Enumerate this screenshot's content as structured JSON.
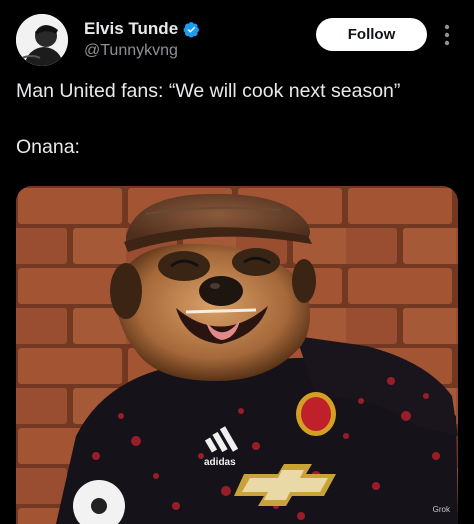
{
  "author": {
    "display_name": "Elvis Tunde",
    "handle": "@Tunnykvng",
    "verified": true,
    "avatar_icon": "avatar-user-icon"
  },
  "actions": {
    "follow_label": "Follow",
    "more_icon": "more-vertical-icon"
  },
  "tweet": {
    "line1": "Man United fans: “We will cook next season”",
    "line2": "Onana:"
  },
  "media": {
    "description_icon": "meerkat-photo",
    "kit_brand_text": "adidas",
    "watermark": "Grok"
  },
  "colors": {
    "background": "#000000",
    "text": "#e7e9ea",
    "secondary_text": "#8b9197",
    "verified_badge": "#1d9bf0",
    "follow_bg": "#ffffff"
  }
}
